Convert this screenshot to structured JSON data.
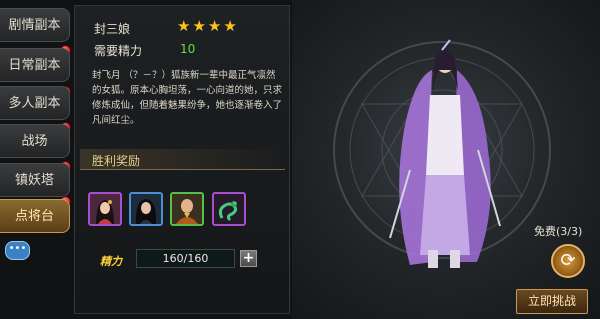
{
  "tabs": [
    {
      "label": "剧情副本",
      "active": false,
      "badge": true
    },
    {
      "label": "日常副本",
      "active": false,
      "badge": true
    },
    {
      "label": "多人副本",
      "active": false,
      "badge": true
    },
    {
      "label": "战场",
      "active": false,
      "badge": true
    },
    {
      "label": "镇妖塔",
      "active": false,
      "badge": true
    },
    {
      "label": "点将台",
      "active": true,
      "badge": false
    }
  ],
  "chat_icon": "chat-bubble-icon",
  "hero": {
    "name": "封三娘",
    "stars": "★★★★",
    "star_count": 4,
    "energy_label": "需要精力",
    "energy_value": "10",
    "story": "封飞月 （？－？）狐族新一辈中最正气凛然的女狐。原本心胸坦荡，一心向道的她，只求修炼成仙，但随着魅果纷争，她也逐渐卷入了凡间红尘。"
  },
  "rewards": {
    "title": "胜利奖励",
    "items": [
      {
        "icon": "female-portrait-icon",
        "frame": "#a74fd0"
      },
      {
        "icon": "dark-haired-portrait-icon",
        "frame": "#4a8fd6"
      },
      {
        "icon": "monk-portrait-icon",
        "frame": "#56c04a"
      },
      {
        "icon": "green-dragon-icon",
        "frame": "#a74fd0"
      }
    ]
  },
  "cost": {
    "label": "精力",
    "value": "160/160",
    "plus": "+"
  },
  "actions": {
    "free_label": "免费(3/3)",
    "refresh_icon": "refresh-arrows-icon",
    "challenge_label": "立即挑战"
  },
  "colors": {
    "accent_gold": "#c39a52",
    "energy_green": "#6ede3e",
    "star_yellow": "#ffc21a"
  }
}
